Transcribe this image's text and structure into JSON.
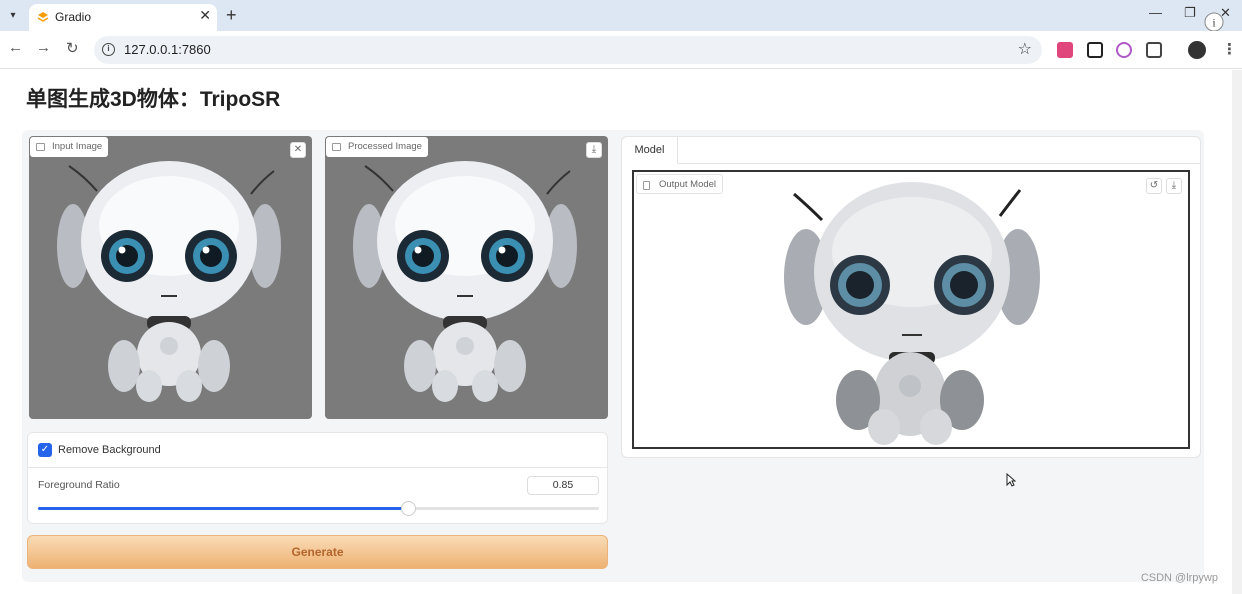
{
  "browser": {
    "tab_title": "Gradio",
    "url": "127.0.0.1:7860"
  },
  "page": {
    "title": "单图生成3D物体：TripoSR"
  },
  "input_panel": {
    "label": "Input Image"
  },
  "processed_panel": {
    "label": "Processed Image"
  },
  "model_panel": {
    "tab_label": "Model",
    "output_label": "Output Model"
  },
  "controls": {
    "remove_background_label": "Remove Background",
    "remove_background_checked": true,
    "foreground_ratio_label": "Foreground Ratio",
    "foreground_ratio_value": "0.85",
    "foreground_ratio_fraction": 0.66
  },
  "generate_label": "Generate",
  "watermark": "CSDN @lrpywp",
  "colors": {
    "accent": "#2563eb",
    "generate_bg": "#f2c08c",
    "generate_text": "#b4652a",
    "panel_bg": "#7b7b7b"
  },
  "icons": {
    "close": "close-icon",
    "download": "download-icon",
    "undo": "undo-icon",
    "image": "image-icon",
    "file": "file-icon",
    "checkmark": "checkmark-icon"
  }
}
